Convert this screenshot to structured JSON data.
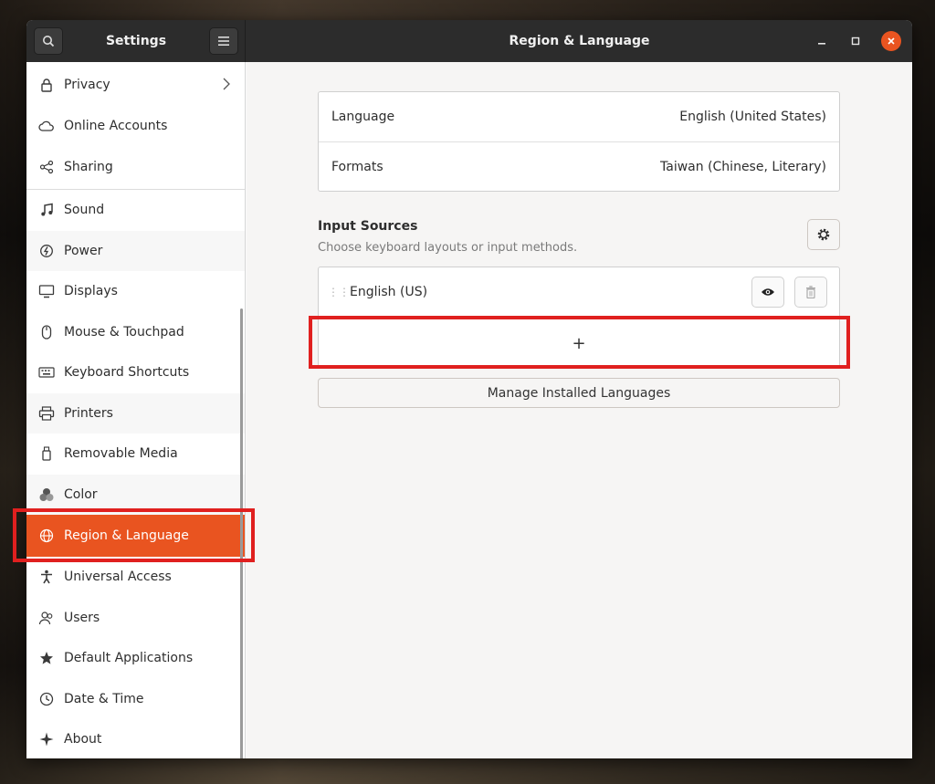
{
  "header": {
    "sidebar_title": "Settings",
    "page_title": "Region & Language",
    "search_icon": "search-icon",
    "menu_icon": "hamburger-menu-icon",
    "minimize_icon": "minimize-icon",
    "maximize_icon": "maximize-icon",
    "close_icon": "close-icon",
    "accent_color": "#e95420"
  },
  "sidebar": {
    "items": [
      {
        "label": "Privacy",
        "icon": "lock-icon"
      },
      {
        "label": "Online Accounts",
        "icon": "cloud-icon"
      },
      {
        "label": "Sharing",
        "icon": "share-icon"
      },
      {
        "label": "Sound",
        "icon": "music-note-icon"
      },
      {
        "label": "Power",
        "icon": "power-icon"
      },
      {
        "label": "Displays",
        "icon": "display-icon"
      },
      {
        "label": "Mouse & Touchpad",
        "icon": "mouse-icon"
      },
      {
        "label": "Keyboard Shortcuts",
        "icon": "keyboard-icon"
      },
      {
        "label": "Printers",
        "icon": "printer-icon"
      },
      {
        "label": "Removable Media",
        "icon": "usb-icon"
      },
      {
        "label": "Color",
        "icon": "color-icon"
      },
      {
        "label": "Region & Language",
        "icon": "globe-icon",
        "active": true
      },
      {
        "label": "Universal Access",
        "icon": "accessibility-icon"
      },
      {
        "label": "Users",
        "icon": "users-icon"
      },
      {
        "label": "Default Applications",
        "icon": "star-icon"
      },
      {
        "label": "Date & Time",
        "icon": "clock-icon"
      },
      {
        "label": "About",
        "icon": "sparkle-icon"
      }
    ]
  },
  "main": {
    "language_label": "Language",
    "language_value": "English (United States)",
    "formats_label": "Formats",
    "formats_value": "Taiwan (Chinese, Literary)",
    "input_sources_title": "Input Sources",
    "input_sources_subtitle": "Choose keyboard layouts or input methods.",
    "input_sources": [
      {
        "label": "English (US)"
      }
    ],
    "add_symbol": "+",
    "manage_button": "Manage Installed Languages"
  }
}
